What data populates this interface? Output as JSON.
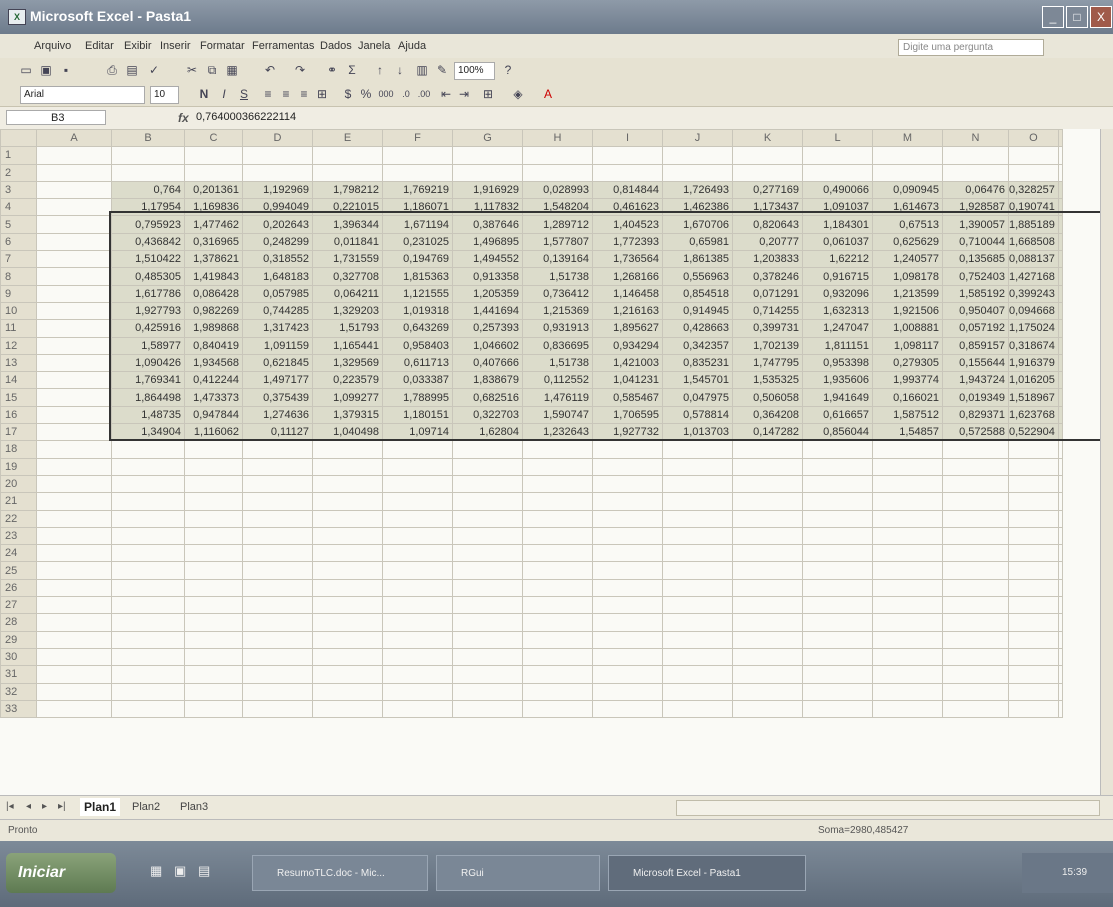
{
  "window": {
    "title": "Microsoft Excel - Pasta1",
    "app_icon": "excel-icon",
    "min_btn": "_",
    "max_btn": "□",
    "close_btn": "X"
  },
  "menu": {
    "items": [
      "Arquivo",
      "Editar",
      "Exibir",
      "Inserir",
      "Formatar",
      "Ferramentas",
      "Dados",
      "Janela",
      "Ajuda"
    ],
    "question_placeholder": "Digite uma pergunta"
  },
  "toolbar": {
    "zoom": "100%",
    "font": "Arial",
    "font_size": "10",
    "bold": "N",
    "italic": "I",
    "underline": "S",
    "percent": "%",
    "thousands": "000",
    "sigma": "Σ"
  },
  "formula_bar": {
    "cell_ref": "B3",
    "fx": "fx",
    "value": "0,764000366222114"
  },
  "sheet": {
    "columns": [
      "A",
      "B",
      "C",
      "D",
      "E",
      "F",
      "G",
      "H",
      "I",
      "J",
      "K",
      "L",
      "M",
      "N",
      "O"
    ],
    "rows": [
      "1",
      "2",
      "3",
      "4",
      "5",
      "6",
      "7",
      "8",
      "9",
      "10",
      "11",
      "12",
      "13",
      "14",
      "15",
      "16",
      "17",
      "18",
      "19",
      "20",
      "21",
      "22",
      "23",
      "24",
      "25",
      "26",
      "27",
      "28",
      "29",
      "30",
      "31",
      "32",
      "33"
    ],
    "data": [
      [
        "0,764",
        "0,201361",
        "1,192969",
        "1,798212",
        "1,769219",
        "1,916929",
        "0,028993",
        "0,814844",
        "1,726493",
        "0,277169",
        "0,490066",
        "0,090945",
        "0,06476",
        "0,328257"
      ],
      [
        "1,17954",
        "1,169836",
        "0,994049",
        "0,221015",
        "1,186071",
        "1,117832",
        "1,548204",
        "0,461623",
        "1,462386",
        "1,173437",
        "1,091037",
        "1,614673",
        "1,928587",
        "0,190741"
      ],
      [
        "0,795923",
        "1,477462",
        "0,202643",
        "1,396344",
        "1,671194",
        "0,387646",
        "1,289712",
        "1,404523",
        "1,670706",
        "0,820643",
        "1,184301",
        "0,67513",
        "1,390057",
        "1,885189"
      ],
      [
        "0,436842",
        "0,316965",
        "0,248299",
        "0,011841",
        "0,231025",
        "1,496895",
        "1,577807",
        "1,772393",
        "0,65981",
        "0,20777",
        "0,061037",
        "0,625629",
        "0,710044",
        "1,668508"
      ],
      [
        "1,510422",
        "1,378621",
        "0,318552",
        "1,731559",
        "0,194769",
        "1,494552",
        "0,139164",
        "1,736564",
        "1,861385",
        "1,203833",
        "1,62212",
        "1,240577",
        "0,135685",
        "0,088137"
      ],
      [
        "0,485305",
        "1,419843",
        "1,648183",
        "0,327708",
        "1,815363",
        "0,913358",
        "1,51738",
        "1,268166",
        "0,556963",
        "0,378246",
        "0,916715",
        "1,098178",
        "0,752403",
        "1,427168"
      ],
      [
        "1,617786",
        "0,086428",
        "0,057985",
        "0,064211",
        "1,121555",
        "1,205359",
        "0,736412",
        "1,146458",
        "0,854518",
        "0,071291",
        "0,932096",
        "1,213599",
        "1,585192",
        "0,399243"
      ],
      [
        "1,927793",
        "0,982269",
        "0,744285",
        "1,329203",
        "1,019318",
        "1,441694",
        "1,215369",
        "1,216163",
        "0,914945",
        "0,714255",
        "1,632313",
        "1,921506",
        "0,950407",
        "0,094668"
      ],
      [
        "0,425916",
        "1,989868",
        "1,317423",
        "1,51793",
        "0,643269",
        "0,257393",
        "0,931913",
        "1,895627",
        "0,428663",
        "0,399731",
        "1,247047",
        "1,008881",
        "0,057192",
        "1,175024"
      ],
      [
        "1,58977",
        "0,840419",
        "1,091159",
        "1,165441",
        "0,958403",
        "1,046602",
        "0,836695",
        "0,934294",
        "0,342357",
        "1,702139",
        "1,811151",
        "1,098117",
        "0,859157",
        "0,318674"
      ],
      [
        "1,090426",
        "1,934568",
        "0,621845",
        "1,329569",
        "0,611713",
        "0,407666",
        "1,51738",
        "1,421003",
        "0,835231",
        "1,747795",
        "0,953398",
        "0,279305",
        "0,155644",
        "1,916379"
      ],
      [
        "1,769341",
        "0,412244",
        "1,497177",
        "0,223579",
        "0,033387",
        "1,838679",
        "0,112552",
        "1,041231",
        "1,545701",
        "1,535325",
        "1,935606",
        "1,993774",
        "1,943724",
        "1,016205"
      ],
      [
        "1,864498",
        "1,473373",
        "0,375439",
        "1,099277",
        "1,788995",
        "0,682516",
        "1,476119",
        "0,585467",
        "0,047975",
        "0,506058",
        "1,941649",
        "0,166021",
        "0,019349",
        "1,518967"
      ],
      [
        "1,48735",
        "0,947844",
        "1,274636",
        "1,379315",
        "1,180151",
        "0,322703",
        "1,590747",
        "1,706595",
        "0,578814",
        "0,364208",
        "0,616657",
        "1,587512",
        "0,829371",
        "1,623768"
      ],
      [
        "1,34904",
        "1,116062",
        "0,11127",
        "1,040498",
        "1,09714",
        "1,62804",
        "1,232643",
        "1,927732",
        "1,013703",
        "0,147282",
        "0,856044",
        "1,54857",
        "0,572588",
        "0,522904"
      ]
    ]
  },
  "tabs": [
    "Plan1",
    "Plan2",
    "Plan3"
  ],
  "status": {
    "left": "Pronto",
    "sum": "Soma=2980,485427"
  },
  "taskbar": {
    "start": "Iniciar",
    "buttons": [
      "ResumoTLC.doc - Mic...",
      "RGui",
      "Microsoft Excel - Pasta1"
    ],
    "clock": "15:39"
  }
}
